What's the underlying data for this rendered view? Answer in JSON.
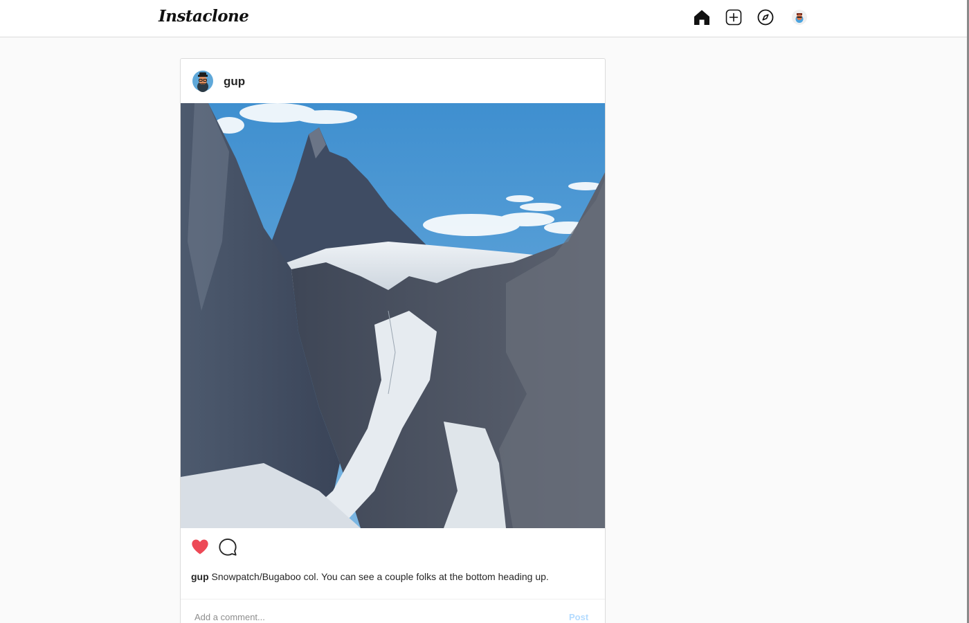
{
  "app": {
    "logo": "Instaclone"
  },
  "nav": {
    "home_icon": "home-icon",
    "add_icon": "plus-square-icon",
    "explore_icon": "compass-icon",
    "avatar_icon": "user-avatar"
  },
  "post": {
    "username": "gup",
    "image_icon": "mountain-photo",
    "liked": true,
    "like_color": "#ed4956",
    "caption_user": "gup",
    "caption_text": "Snowpatch/Bugaboo col. You can see a couple folks at the bottom heading up."
  },
  "comment": {
    "placeholder": "Add a comment...",
    "post_label": "Post",
    "post_color": "#b3dbff"
  }
}
